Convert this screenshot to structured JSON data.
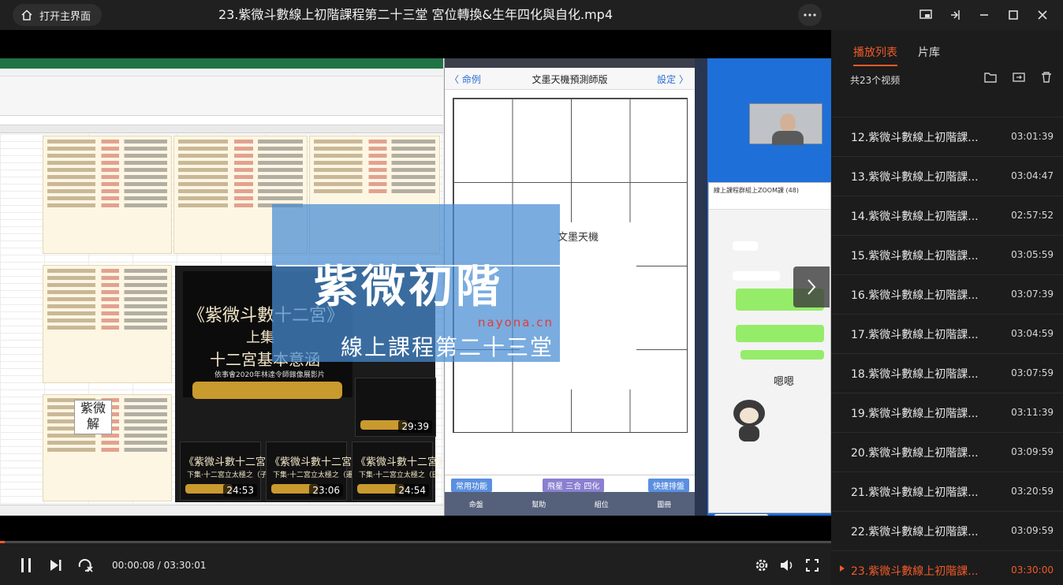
{
  "titlebar": {
    "home_label": "打开主界面",
    "title": "23.紫微斗數線上初階課程第二十三堂  宮位轉換&生年四化與自化.mp4"
  },
  "slide": {
    "big_title": "紫微初階",
    "sub_title": "線上課程第二十三堂",
    "watermark": "nayona.cn"
  },
  "book": {
    "title": "《紫微斗數十二宮》",
    "sub1": "上集",
    "sub2": "十二宮基本意涵",
    "credit": "依事會2020年林達令師錄像展影片"
  },
  "tiles": [
    {
      "title": "《紫微斗數十二宮》",
      "subtitle": "下集·十二宮立太極之（子、財、疾）",
      "duration": "24:53"
    },
    {
      "title": "《紫微斗數十二宮》",
      "subtitle": "下集·十二宮立太極之（遷、奴、官）",
      "duration": "23:06"
    },
    {
      "title": "《紫微斗數十二宮》",
      "subtitle": "下集·十二宮立太極之（田、福、父）",
      "duration": "24:54"
    },
    {
      "title": "",
      "subtitle": "",
      "duration": "29:39"
    }
  ],
  "app": {
    "back": "〈 命例",
    "name": "文墨天機預測師版",
    "settings": "設定 〉",
    "center_name": "文墨天機",
    "btn_common": "常用功能",
    "mode": "飛星 三合 四化",
    "btn_quick": "快捷排盤",
    "dock": [
      "命盤",
      "幫助",
      "組位",
      "圖冊"
    ]
  },
  "chat": {
    "header": "線上課程群組上ZOOM課 (48)",
    "reply": "嗯嗯"
  },
  "stamp": "紫微解",
  "player": {
    "time": "00:00:08 / 03:30:01",
    "progress": 0.0006,
    "accent": "#f05a28"
  },
  "sidebar": {
    "tab_playlist": "播放列表",
    "tab_library": "片库",
    "count": "共23个视频",
    "items": [
      {
        "title": "12.紫微斗數線上初階課...",
        "duration": "03:01:39"
      },
      {
        "title": "13.紫微斗數線上初階課...",
        "duration": "03:04:47"
      },
      {
        "title": "14.紫微斗數線上初階課...",
        "duration": "02:57:52"
      },
      {
        "title": "15.紫微斗數線上初階課...",
        "duration": "03:05:59"
      },
      {
        "title": "16.紫微斗數線上初階課...",
        "duration": "03:07:39"
      },
      {
        "title": "17.紫微斗數線上初階課...",
        "duration": "03:04:59"
      },
      {
        "title": "18.紫微斗數線上初階課...",
        "duration": "03:07:59"
      },
      {
        "title": "19.紫微斗數線上初階課...",
        "duration": "03:11:39"
      },
      {
        "title": "20.紫微斗數線上初階課...",
        "duration": "03:09:59"
      },
      {
        "title": "21.紫微斗數線上初階課...",
        "duration": "03:20:59"
      },
      {
        "title": "22.紫微斗數線上初階課...",
        "duration": "03:09:59"
      },
      {
        "title": "23.紫微斗數線上初階課...",
        "duration": "03:30:00"
      }
    ],
    "current_index": 11
  }
}
